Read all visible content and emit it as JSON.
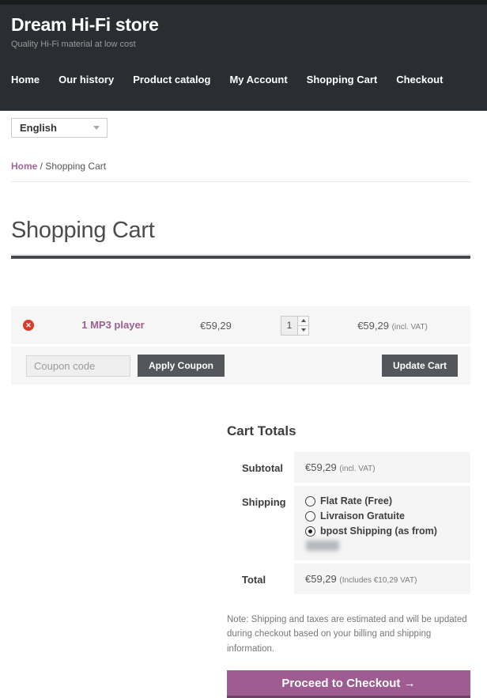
{
  "site": {
    "title": "Dream Hi-Fi store",
    "tagline": "Quality Hi-Fi material at low cost"
  },
  "nav": {
    "items": [
      {
        "label": "Home"
      },
      {
        "label": "Our history"
      },
      {
        "label": "Product catalog"
      },
      {
        "label": "My Account"
      },
      {
        "label": "Shopping Cart"
      },
      {
        "label": "Checkout"
      }
    ]
  },
  "language_select": {
    "value": "English"
  },
  "breadcrumb": {
    "home": "Home",
    "separator": " / ",
    "current": "Shopping Cart"
  },
  "page": {
    "title": "Shopping Cart"
  },
  "cart": {
    "item": {
      "name": "1 MP3 player",
      "price": "€59,29",
      "quantity": "1",
      "line_total": "€59,29",
      "line_total_suffix": "(incl. VAT)"
    },
    "coupon": {
      "placeholder": "Coupon code",
      "apply_label": "Apply Coupon"
    },
    "update_label": "Update Cart"
  },
  "totals": {
    "heading": "Cart Totals",
    "subtotal_label": "Subtotal",
    "subtotal_value": "€59,29",
    "subtotal_suffix": "(incl. VAT)",
    "shipping_label": "Shipping",
    "shipping_options": [
      {
        "label": "Flat Rate (Free)",
        "selected": false
      },
      {
        "label": "Livraison Gratuite",
        "selected": false
      },
      {
        "label": "bpost Shipping (as from)",
        "selected": true
      }
    ],
    "total_label": "Total",
    "total_value": "€59,29",
    "total_suffix": "(Includes €10,29 VAT)",
    "note": "Note: Shipping and taxes are estimated and will be updated during checkout based on your billing and shipping information.",
    "checkout_label": "Proceed to Checkout →"
  },
  "theme": {
    "header_bg": "#2a2d31",
    "accent_purple": "#a46497",
    "checkout_purple": "#9f5c92",
    "button_dark": "#53565b",
    "row_bg": "#f6f6f6",
    "remove_red": "#dd3b27"
  }
}
